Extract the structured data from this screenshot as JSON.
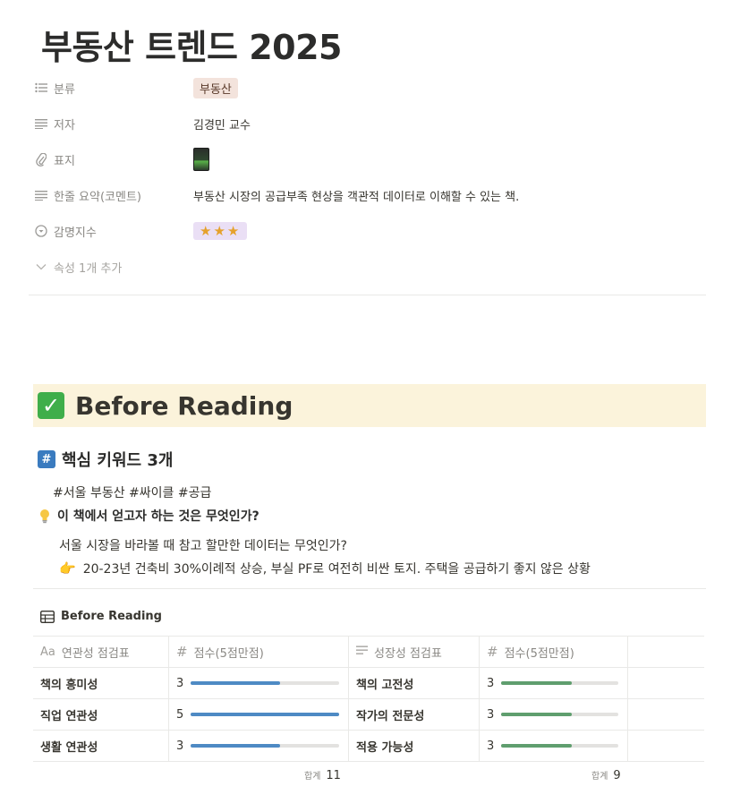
{
  "page": {
    "title": "부동산 트렌드 2025"
  },
  "properties": {
    "category": {
      "label": "분류",
      "value": "부동산"
    },
    "author": {
      "label": "저자",
      "value": "김경민 교수"
    },
    "cover": {
      "label": "표지"
    },
    "summary": {
      "label": "한줄 요약(코멘트)",
      "value": "부동산 시장의 공급부족 현상을 객관적 데이터로 이해할 수 있는 책."
    },
    "rating": {
      "label": "감명지수",
      "value": "★★★"
    },
    "add_property": "속성 1개 추가"
  },
  "callout": {
    "title": "Before Reading"
  },
  "keywords_section": {
    "heading": "핵심 키워드 3개",
    "keywords": "#서울 부동산 #싸이클 #공급"
  },
  "question_section": {
    "question": "이 책에서 얻고자 하는 것은 무엇인가?",
    "answer_line1": "서울 시장을 바라볼 때 참고 할만한 데이터는 무엇인가?",
    "answer_line2": "20-23년 건축비 30%이례적 상승, 부실 PF로 여전히 비싼 토지. 주택을 공급하기 좋지 않은 상황"
  },
  "database": {
    "title": "Before Reading",
    "headers": {
      "col1": "연관성 점검표",
      "col2": "점수(5점만점)",
      "col3": "성장성 점검표",
      "col4": "점수(5점만점)"
    },
    "header_icons": {
      "col1": "Aa",
      "col2": "#",
      "col4": "#"
    },
    "max_score": 5,
    "rows": [
      {
        "name1": "책의 흥미성",
        "score1": 3,
        "name2": "책의 고전성",
        "score2": 3
      },
      {
        "name1": "직업 연관성",
        "score1": 5,
        "name2": "작가의 전문성",
        "score2": 3
      },
      {
        "name1": "생활 연관성",
        "score1": 3,
        "name2": "적용 가능성",
        "score2": 3
      }
    ],
    "sum_label": "합계",
    "sum1": 11,
    "sum2": 9
  },
  "colors": {
    "bar_blue": "#4e8ac4",
    "bar_green": "#5f9e6e",
    "callout_bg": "#fbf3db",
    "tag_brown_bg": "#f3e3dc",
    "tag_purple_bg": "#eadff5"
  }
}
